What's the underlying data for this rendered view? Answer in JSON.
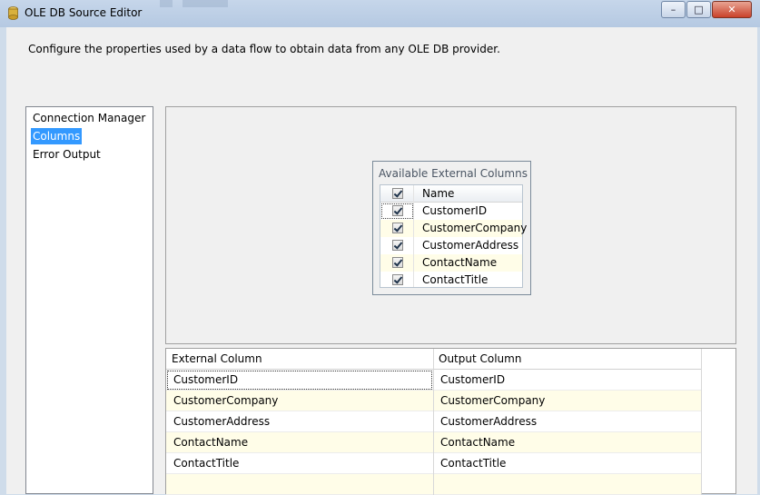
{
  "window": {
    "title": "OLE DB Source Editor",
    "minimize": "–",
    "maximize": "□",
    "close": "✕"
  },
  "description": "Configure the properties used by a data flow to obtain data from any OLE DB provider.",
  "nav": {
    "items": [
      {
        "label": "Connection Manager",
        "selected": false
      },
      {
        "label": "Columns",
        "selected": true
      },
      {
        "label": "Error Output",
        "selected": false
      }
    ]
  },
  "available_columns": {
    "title": "Available External Columns",
    "header": "Name",
    "rows": [
      {
        "name": "CustomerID",
        "checked": true
      },
      {
        "name": "CustomerCompany",
        "checked": true
      },
      {
        "name": "CustomerAddress",
        "checked": true
      },
      {
        "name": "ContactName",
        "checked": true
      },
      {
        "name": "ContactTitle",
        "checked": true
      }
    ]
  },
  "mapping_grid": {
    "headers": [
      "External Column",
      "Output Column"
    ],
    "rows": [
      {
        "external": "CustomerID",
        "output": "CustomerID"
      },
      {
        "external": "CustomerCompany",
        "output": "CustomerCompany"
      },
      {
        "external": "CustomerAddress",
        "output": "CustomerAddress"
      },
      {
        "external": "ContactName",
        "output": "ContactName"
      },
      {
        "external": "ContactTitle",
        "output": "ContactTitle"
      }
    ]
  },
  "colors": {
    "selection": "#3399ff",
    "alt_row": "#fffde8"
  }
}
